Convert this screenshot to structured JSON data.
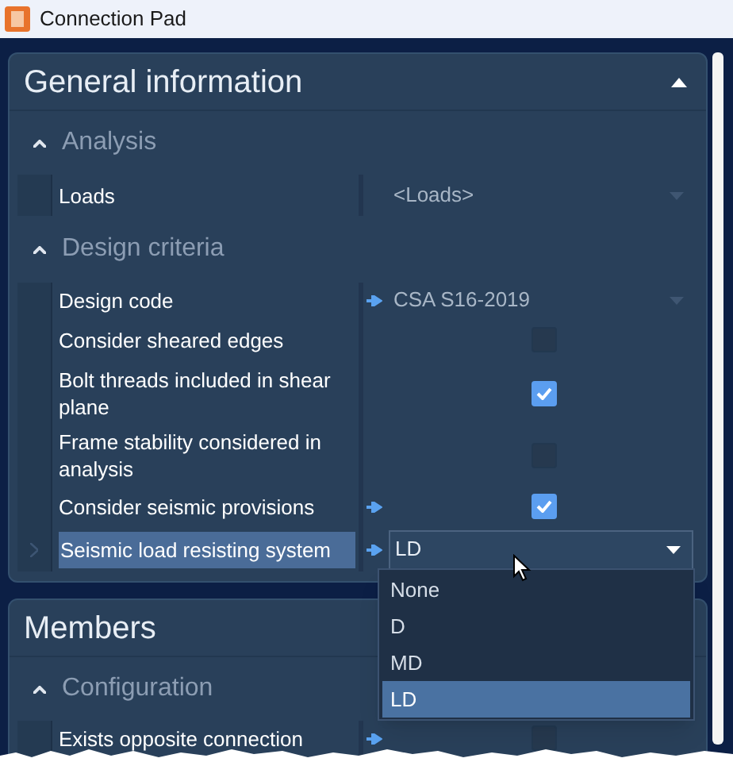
{
  "window": {
    "title": "Connection Pad"
  },
  "sections": [
    {
      "title": "General information",
      "expanded": true,
      "groups": [
        {
          "title": "Analysis",
          "expanded": true,
          "rows": [
            {
              "kind": "dropdown",
              "label": "Loads",
              "value": "<Loads>",
              "linked": false,
              "selected": false,
              "open": false
            }
          ]
        },
        {
          "title": "Design criteria",
          "expanded": true,
          "rows": [
            {
              "kind": "dropdown",
              "label": "Design code",
              "value": "CSA S16-2019",
              "linked": true,
              "selected": false,
              "open": false
            },
            {
              "kind": "checkbox",
              "label": "Consider sheared edges",
              "checked": false,
              "linked": false,
              "selected": false
            },
            {
              "kind": "checkbox",
              "label": "Bolt threads included in shear plane",
              "checked": true,
              "linked": false,
              "selected": false
            },
            {
              "kind": "checkbox",
              "label": "Frame stability considered in analysis",
              "checked": false,
              "linked": false,
              "selected": false
            },
            {
              "kind": "checkbox",
              "label": "Consider seismic provisions",
              "checked": true,
              "linked": true,
              "selected": false
            },
            {
              "kind": "dropdown",
              "label": "Seismic load resisting system",
              "value": "LD",
              "linked": true,
              "selected": true,
              "open": true,
              "options": [
                {
                  "label": "None",
                  "selected": false
                },
                {
                  "label": "D",
                  "selected": false
                },
                {
                  "label": "MD",
                  "selected": false
                },
                {
                  "label": "LD",
                  "selected": true
                }
              ]
            }
          ]
        }
      ]
    },
    {
      "title": "Members",
      "groups": [
        {
          "title": "Configuration",
          "expanded": true,
          "rows": [
            {
              "kind": "checkbox",
              "label": "Exists opposite connection",
              "checked": false,
              "linked": true,
              "selected": false
            }
          ]
        }
      ]
    }
  ]
}
